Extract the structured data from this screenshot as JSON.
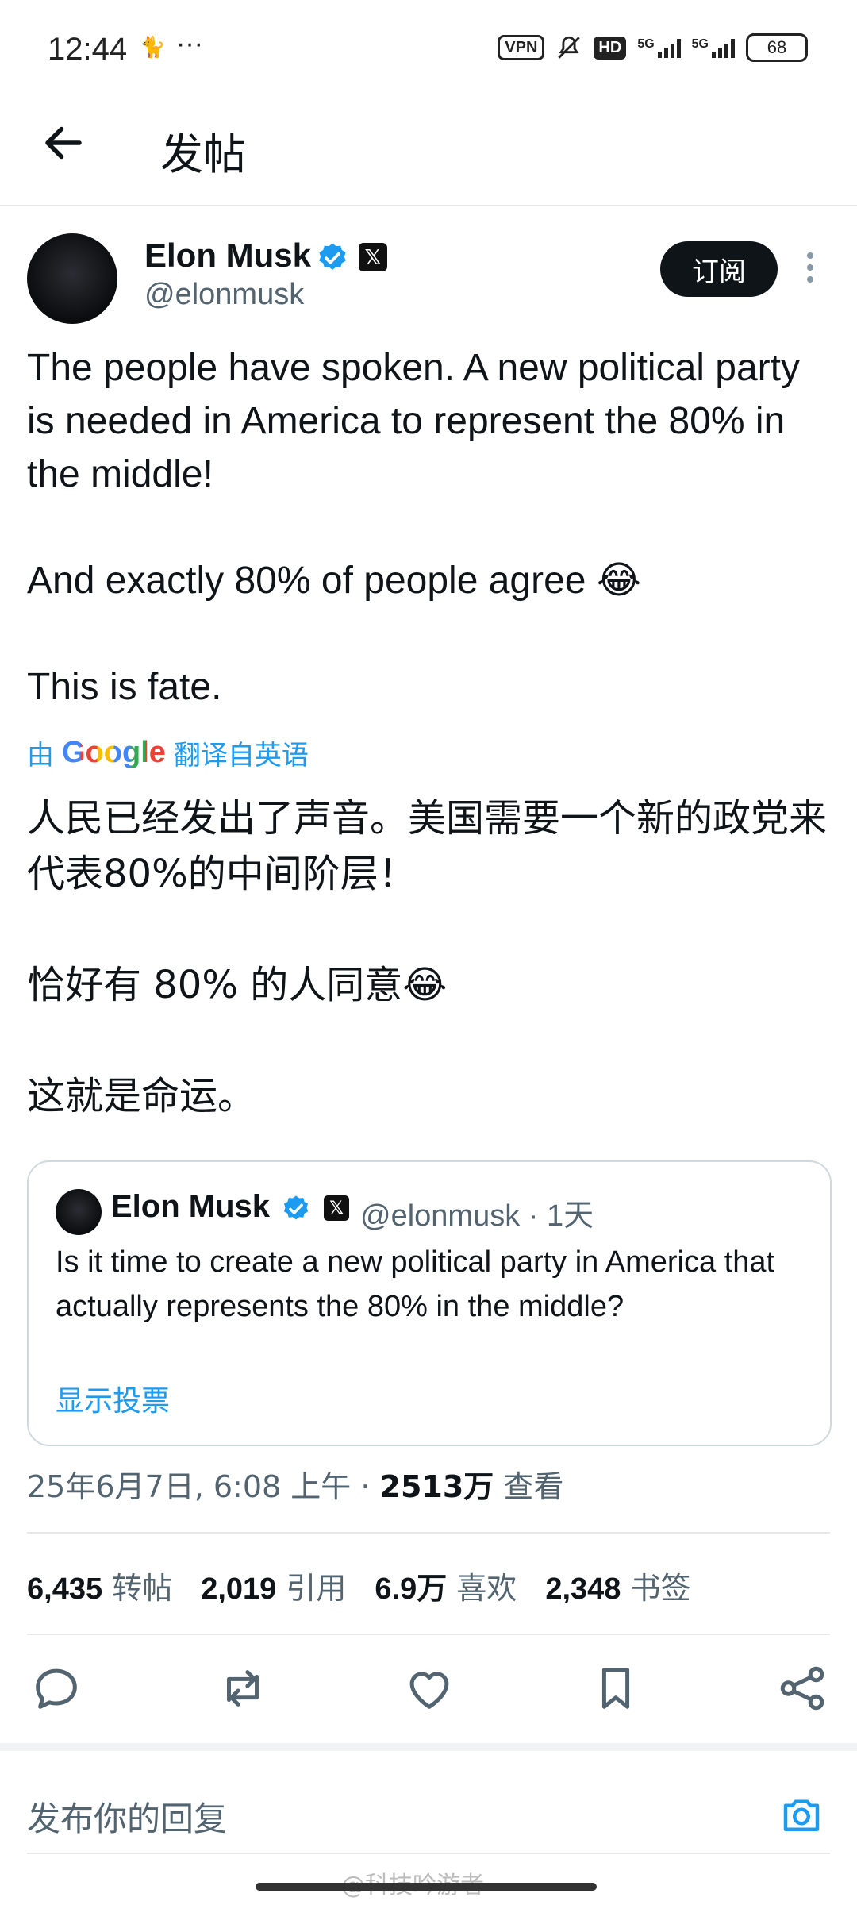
{
  "status_bar": {
    "time": "12:44",
    "dots": "···",
    "vpn": "VPN",
    "hd": "HD",
    "net1": "5G",
    "net2": "5G",
    "battery": "68"
  },
  "header": {
    "title": "发帖"
  },
  "post": {
    "author_name": "Elon Musk",
    "author_handle": "@elonmusk",
    "x_badge": "𝕏",
    "subscribe_label": "订阅",
    "text": "The people have spoken. A new political party is needed in America to represent the 80% in the middle!\n\nAnd exactly 80% of people agree 😂\n\nThis is fate.",
    "translate_prefix": "由",
    "translate_brand": "Google",
    "translate_suffix": "翻译自英语",
    "translated_text": "人民已经发出了声音。美国需要一个新的政党来代表80%的中间阶层！\n\n恰好有 80% 的人同意😂\n\n这就是命运。",
    "quote": {
      "author_name": "Elon Musk",
      "handle_time": "@elonmusk · 1天",
      "text": "Is it time to create a new political party in America that actually represents the 80% in the middle?",
      "poll_link": "显示投票"
    },
    "meta_date": "25年6月7日, 6:08 上午 · ",
    "meta_views": "2513万",
    "meta_views_label": " 查看",
    "stats": [
      {
        "value": "6,435",
        "label": "转帖"
      },
      {
        "value": "2,019",
        "label": "引用"
      },
      {
        "value": "6.9万",
        "label": "喜欢"
      },
      {
        "value": "2,348",
        "label": "书签"
      }
    ]
  },
  "reply": {
    "placeholder": "发布你的回复"
  },
  "watermark": "@科技吟游者",
  "colors": {
    "accent": "#1d9bf0",
    "text": "#0f1419",
    "muted": "#536471"
  }
}
